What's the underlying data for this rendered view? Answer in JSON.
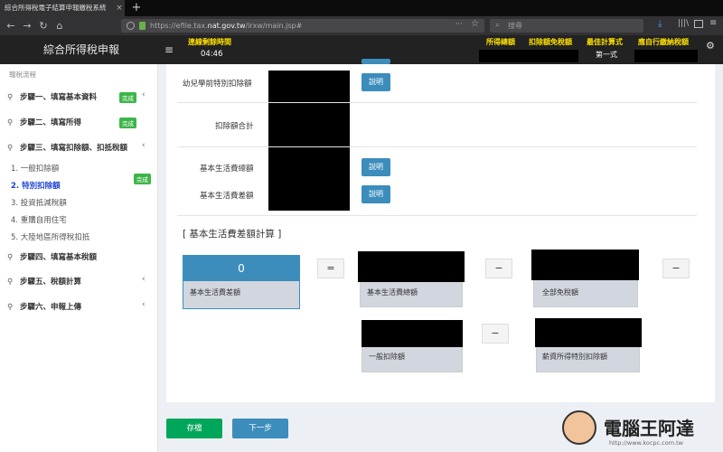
{
  "browser": {
    "tab_title": "綜合所得稅電子結算申報繳稅系統",
    "tab_close": "×",
    "new_tab": "+",
    "url_prefix": "https://efile.tax.",
    "url_domain": "nat.gov.tw",
    "url_path": "/irxw/main.jsp#",
    "search_placeholder": "搜尋",
    "nav_back": "←",
    "nav_forward": "→",
    "nav_reload": "↻",
    "nav_home": "⌂",
    "more": "···"
  },
  "header": {
    "title": "綜合所得稅申報",
    "menu_icon": "≡",
    "countdown_label": "連線剩餘時間",
    "countdown_value": "04:46",
    "income_total_label": "所得總額",
    "deduction_label": "扣除額免稅額",
    "best_formula_label": "最佳計算式",
    "tax_due_label": "應自行繳納稅額",
    "best_formula_value": "第一式",
    "settings_icon": "⚙"
  },
  "sidebar": {
    "flow_title": "報稅流程",
    "steps": [
      {
        "label": "步驟一、填寫基本資料",
        "badge": "完成",
        "chevron": "‹"
      },
      {
        "label": "步驟二、填寫所得",
        "badge": "完成",
        "chevron": ""
      },
      {
        "label": "步驟三、填寫扣除額、扣抵稅額",
        "badge": "",
        "chevron": "‹"
      },
      {
        "label": "步驟四、填寫基本稅額",
        "badge": "",
        "chevron": ""
      },
      {
        "label": "步驟五、稅額計算",
        "badge": "",
        "chevron": "‹"
      },
      {
        "label": "步驟六、申報上傳",
        "badge": "",
        "chevron": "‹"
      }
    ],
    "substeps": [
      "1. 一般扣除額",
      "2. 特別扣除額",
      "3. 投資抵減稅額",
      "4. 重購自用住宅",
      "5. 大陸地區所得稅扣抵"
    ],
    "substep_badge": "完成",
    "step_icon": "⚲"
  },
  "form": {
    "preschool_label": "幼兒學前特別扣除額",
    "deduction_total_label": "扣除額合計",
    "living_cost_total_label": "基本生活費總額",
    "living_cost_diff_label": "基本生活費差額",
    "explain_label": "說明"
  },
  "calc": {
    "section_title": "[ 基本生活費差額計算 ]",
    "result_value": "0",
    "result_label": "基本生活費差額",
    "equals": "=",
    "minus": "−",
    "living_cost_total": "基本生活費總額",
    "full_exemption": "全部免稅額",
    "general_deduction": "一般扣除額",
    "salary_deduction": "薪資所得特別扣除額"
  },
  "footer": {
    "save_label": "存檔",
    "next_label": "下一步"
  },
  "watermark": {
    "brand": "電腦王阿達",
    "url": "http://www.kocpc.com.tw"
  },
  "colors": {
    "accent": "#3c8dbc",
    "success": "#00a65a",
    "done_badge": "#3cb54a",
    "header_bg": "#222222",
    "yellow": "#ffe000"
  }
}
